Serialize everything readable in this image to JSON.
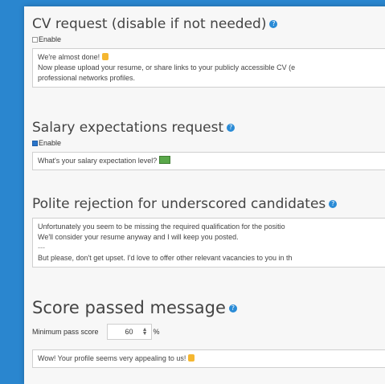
{
  "cv": {
    "title": "CV request (disable if not needed)",
    "enable_label": "Enable",
    "enabled": false,
    "line1": "We're almost done!",
    "line2": "Now please upload your resume, or share links to your publicly accessible CV (e",
    "line3": "professional networks profiles."
  },
  "salary": {
    "title": "Salary expectations request",
    "enable_label": "Enable",
    "enabled": true,
    "line1": "What's your salary expectation level?"
  },
  "rejection": {
    "title": "Polite rejection for underscored candidates",
    "line1": "Unfortunately you seem to be missing the required qualification for the positio",
    "line2": "We'll consider your resume anyway and I will keep you posted.",
    "line3": "---",
    "line4": "But please, don't get upset. I'd love to offer other relevant vacancies to you in th"
  },
  "score": {
    "title": "Score passed message",
    "min_label": "Minimum pass score",
    "min_value": "60",
    "unit": "%",
    "message": "Wow! Your profile seems very appealing to us!"
  },
  "icons": {
    "help": "help-circle-icon",
    "hand": "raised-hand-emoji",
    "money": "money-emoji"
  }
}
